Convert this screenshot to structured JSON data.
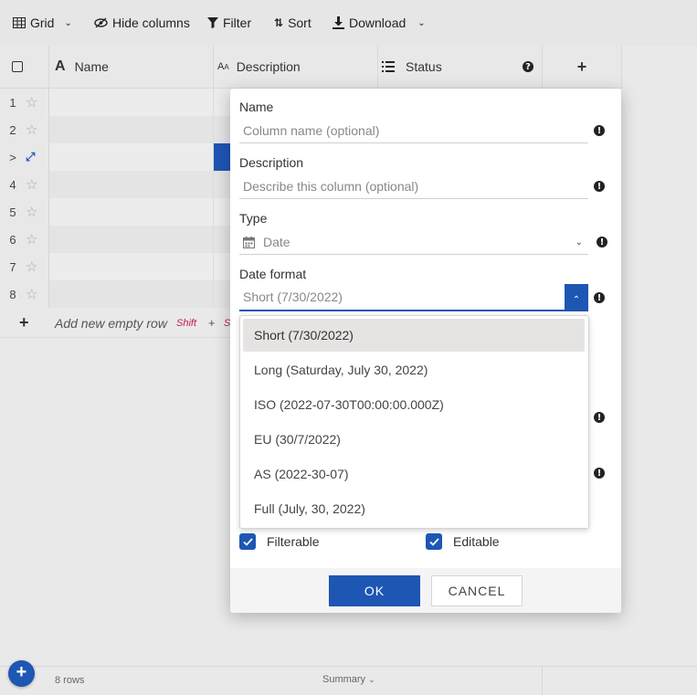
{
  "toolbar": {
    "grid_label": "Grid",
    "hide_columns_label": "Hide columns",
    "filter_label": "Filter",
    "sort_label": "Sort",
    "download_label": "Download"
  },
  "columns": {
    "name": "Name",
    "description": "Description",
    "status": "Status"
  },
  "rows": [
    {
      "num": "1"
    },
    {
      "num": "2"
    },
    {
      "num": ">"
    },
    {
      "num": "4"
    },
    {
      "num": "5"
    },
    {
      "num": "6"
    },
    {
      "num": "7"
    },
    {
      "num": "8"
    }
  ],
  "add_row": {
    "label": "Add new empty row",
    "shortcut_key": "Shift",
    "plus": "+",
    "shortcut_key2": "S"
  },
  "footer": {
    "row_count": "8 rows",
    "summary_label": "Summary"
  },
  "modal": {
    "name_label": "Name",
    "name_placeholder": "Column name (optional)",
    "description_label": "Description",
    "description_placeholder": "Describe this column (optional)",
    "type_label": "Type",
    "type_value": "Date",
    "date_format_label": "Date format",
    "date_format_value": "Short (7/30/2022)",
    "date_format_options": [
      "Short (7/30/2022)",
      "Long (Saturday, July 30, 2022)",
      "ISO (2022-07-30T00:00:00.000Z)",
      "EU (30/7/2022)",
      "AS (2022-30-07)",
      "Full (July, 30, 2022)"
    ],
    "filterable_label": "Filterable",
    "editable_label": "Editable",
    "ok_label": "OK",
    "cancel_label": "CANCEL"
  },
  "colors": {
    "accent": "#1e56b3",
    "shortcut": "#c2185b"
  }
}
